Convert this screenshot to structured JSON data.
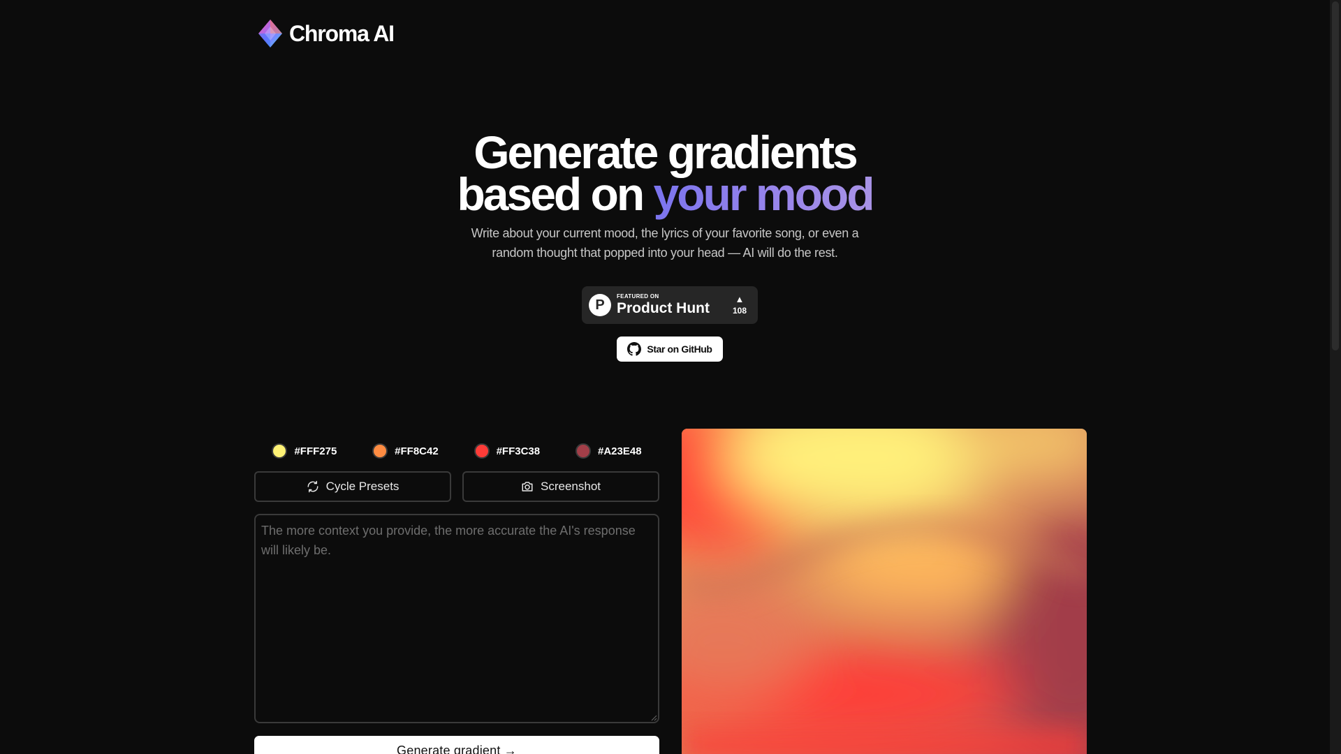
{
  "brand": {
    "name": "Chroma AI",
    "logo_icon": "diamond-logo-icon"
  },
  "hero": {
    "title_line1": "Generate gradients",
    "title_line2_plain": "based on ",
    "title_line2_accent": "your mood",
    "accent_color": "#8b7ded",
    "subtitle": "Write about your current mood, the lyrics of your favorite song, or even a random thought that popped into your head — AI will do the rest."
  },
  "product_hunt": {
    "logo_letter": "P",
    "featured_label": "FEATURED ON",
    "name": "Product Hunt",
    "upvote_icon": "triangle-up-icon",
    "votes": "108"
  },
  "github": {
    "label": "Star on GitHub",
    "icon": "github-icon"
  },
  "palette": [
    {
      "hex": "#FFF275",
      "color": "#FFF275"
    },
    {
      "hex": "#FF8C42",
      "color": "#FF8C42"
    },
    {
      "hex": "#FF3C38",
      "color": "#FF3C38"
    },
    {
      "hex": "#A23E48",
      "color": "#A23E48"
    }
  ],
  "actions": {
    "cycle_label": "Cycle Presets",
    "cycle_icon": "refresh-icon",
    "screenshot_label": "Screenshot",
    "screenshot_icon": "camera-icon"
  },
  "prompt": {
    "value": "",
    "placeholder": "The more context you provide, the more accurate the AI's response will likely be."
  },
  "generate": {
    "label": "Generate gradient →"
  }
}
